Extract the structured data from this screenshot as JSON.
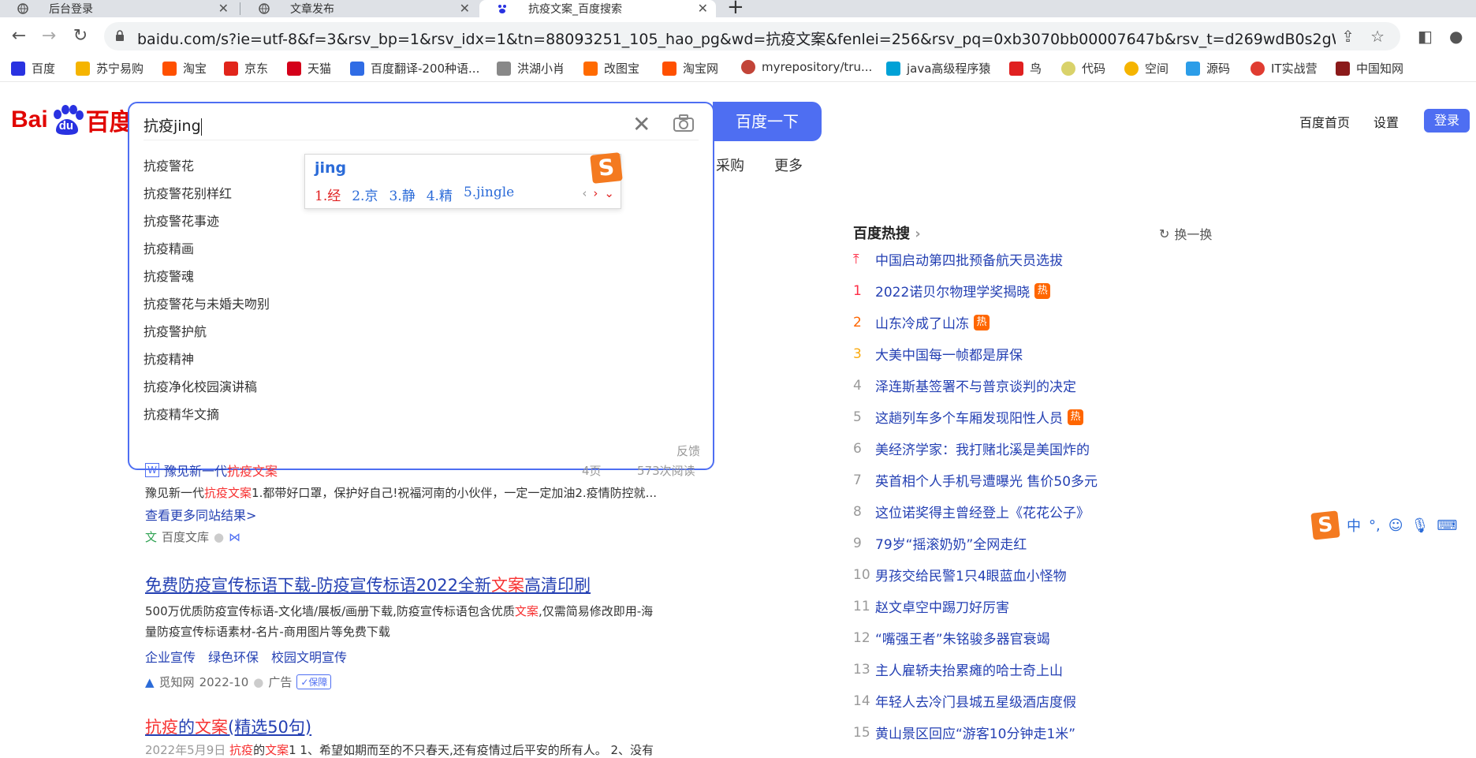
{
  "browser": {
    "tabs": [
      {
        "label": "后台登录"
      },
      {
        "label": "文章发布"
      },
      {
        "label": "抗疫文案_百度搜索"
      }
    ],
    "url": "baidu.com/s?ie=utf-8&f=3&rsv_bp=1&rsv_idx=1&tn=88093251_105_hao_pg&wd=抗疫文案&fenlei=256&rsv_pq=0xb3070bb00007647b&rsv_t=d269wdB0s2gWUcnUFXH02MjId8...",
    "bookmarks": [
      {
        "label": "百度",
        "color": "#2932e1"
      },
      {
        "label": "苏宁易购",
        "color": "#f5b400"
      },
      {
        "label": "淘宝",
        "color": "#ff5000"
      },
      {
        "label": "京东",
        "color": "#e1251b"
      },
      {
        "label": "天猫",
        "color": "#d4001a"
      },
      {
        "label": "百度翻译-200种语...",
        "color": "#2f6ce5"
      },
      {
        "label": "洪湖小肖",
        "color": "#888888"
      },
      {
        "label": "改图宝",
        "color": "#ff6a00"
      },
      {
        "label": "淘宝网",
        "color": "#ff5000"
      },
      {
        "label": "myrepository/tru...",
        "color": "#c24438"
      },
      {
        "label": "java高级程序猿",
        "color": "#00a1d6"
      },
      {
        "label": "鸟",
        "color": "#e02020"
      },
      {
        "label": "代码",
        "color": "#d9d26a"
      },
      {
        "label": "空间",
        "color": "#f5b400"
      },
      {
        "label": "源码",
        "color": "#2b9de8"
      },
      {
        "label": "IT实战营",
        "color": "#e03c31"
      },
      {
        "label": "中国知网",
        "color": "#8b1a1a"
      }
    ]
  },
  "logo": {
    "text_left": "Bai",
    "text_right": "百度",
    "du": "du"
  },
  "search": {
    "query": "抗疫jing",
    "button": "百度一下",
    "suggestions": [
      "抗疫警花",
      "抗疫警花别样红",
      "抗疫警花事迹",
      "抗疫精画",
      "抗疫警魂",
      "抗疫警花与未婚夫吻别",
      "抗疫警护航",
      "抗疫精神",
      "抗疫净化校园演讲稿",
      "抗疫精华文摘"
    ],
    "feedback": "反馈"
  },
  "ime": {
    "composition": "jing",
    "candidates": [
      "1.经",
      "2.京",
      "3.静",
      "4.精",
      "5.jingle"
    ]
  },
  "behind_tabs": {
    "caigou": "采购",
    "more": "更多"
  },
  "header_links": {
    "home": "百度首页",
    "settings": "设置",
    "login": "登录"
  },
  "results": {
    "doc": {
      "title_pre": "豫见新一代",
      "title_hl": "抗疫文案",
      "pages": "4页",
      "reads": "573次阅读",
      "snippet_pre": "豫见新一代",
      "snippet_hl": "抗疫文案",
      "snippet_post": "1.都带好口罩，保护好自己!祝福河南的小伙伴，一定一定加油2.疫情防控就...",
      "more": "查看更多同站结果>",
      "source": "百度文库"
    },
    "ad": {
      "title_pre": "免费防疫宣传标语下载-防疫宣传标语2022全新",
      "title_hl": "文案",
      "title_post": "高清印刷",
      "line1_pre": "500万优质防疫宣传标语-文化墙/展板/画册下载,防疫宣传标语包含优质",
      "line1_hl": "文案",
      "line1_post": ",仅需简易修改即用-海",
      "line2": "量防疫宣传标语素材-名片-商用图片等免费下载",
      "links": [
        "企业宣传",
        "绿色环保",
        "校园文明宣传"
      ],
      "source": "觅知网",
      "date": "2022-10",
      "ad_label": "广告",
      "badge": "保障"
    },
    "third": {
      "t1": "抗疫",
      "t2": "的",
      "t3": "文案",
      "t4": "(精选50句)",
      "date": "2022年5月9日",
      "s_hl1": "抗疫",
      "s_mid": "的",
      "s_hl2": "文案",
      "s_post": "1 1、希望如期而至的不只春天,还有疫情过后平安的所有人。 2、没有"
    }
  },
  "hot": {
    "title": "百度热搜",
    "refresh": "换一换",
    "items": [
      {
        "rank": "",
        "title": "中国启动第四批预备航天员选拔",
        "badge": ""
      },
      {
        "rank": "1",
        "title": "2022诺贝尔物理学奖揭晓",
        "badge": "热"
      },
      {
        "rank": "2",
        "title": "山东冷成了山冻",
        "badge": "热"
      },
      {
        "rank": "3",
        "title": "大美中国每一帧都是屏保",
        "badge": ""
      },
      {
        "rank": "4",
        "title": "泽连斯基签署不与普京谈判的决定",
        "badge": ""
      },
      {
        "rank": "5",
        "title": "这趟列车多个车厢发现阳性人员",
        "badge": "热"
      },
      {
        "rank": "6",
        "title": "美经济学家：我打赌北溪是美国炸的",
        "badge": ""
      },
      {
        "rank": "7",
        "title": "英首相个人手机号遭曝光 售价50多元",
        "badge": ""
      },
      {
        "rank": "8",
        "title": "这位诺奖得主曾经登上《花花公子》",
        "badge": ""
      },
      {
        "rank": "9",
        "title": "79岁“摇滚奶奶”全网走红",
        "badge": ""
      },
      {
        "rank": "10",
        "title": "男孩交给民警1只4眼蓝血小怪物",
        "badge": ""
      },
      {
        "rank": "11",
        "title": "赵文卓空中踢刀好厉害",
        "badge": ""
      },
      {
        "rank": "12",
        "title": "“嘴强王者”朱铭骏多器官衰竭",
        "badge": ""
      },
      {
        "rank": "13",
        "title": "主人雇轿夫抬累瘫的哈士奇上山",
        "badge": ""
      },
      {
        "rank": "14",
        "title": "年轻人去冷门县城五星级酒店度假",
        "badge": ""
      },
      {
        "rank": "15",
        "title": "黄山景区回应“游客10分钟走1米”",
        "badge": ""
      }
    ]
  },
  "ime_bar": {
    "mode": "中",
    "punct": "°,"
  }
}
